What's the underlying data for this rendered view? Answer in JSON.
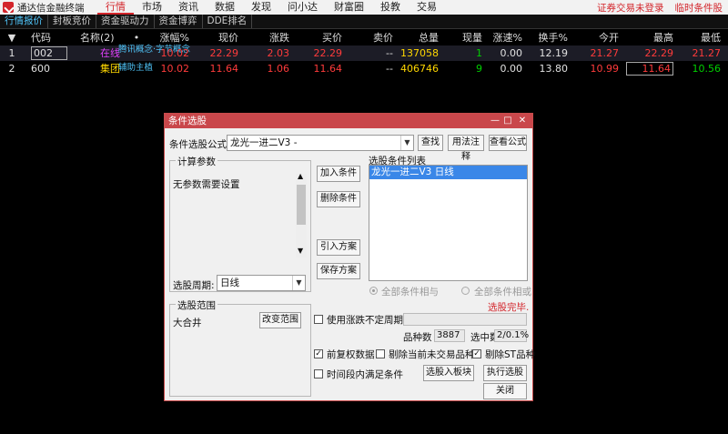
{
  "app": {
    "title": "通达信金融终端"
  },
  "menu": {
    "items": [
      "行情",
      "市场",
      "资讯",
      "数据",
      "发现",
      "问小达",
      "财富圈",
      "投教",
      "交易"
    ],
    "right": [
      "证券交易未登录",
      "临时条件股"
    ]
  },
  "subtabs": [
    "行情报价",
    "封板竞价",
    "资金驱动力",
    "资金博弈",
    "DDE排名"
  ],
  "table": {
    "headers": {
      "sort": "▼",
      "code": "代码",
      "name": "名称(2)",
      "dot": "•",
      "pct": "涨幅%",
      "price": "现价",
      "chg": "涨跌",
      "bid": "买价",
      "ask": "卖价",
      "vol": "总量",
      "cur": "现量",
      "spd": "涨速%",
      "turn": "换手%",
      "open": "今开",
      "high": "最高",
      "low": "最低"
    },
    "rows": [
      {
        "num": "1",
        "code": "002",
        "name": "在线",
        "tag": "腾讯概念·字节概念",
        "pct": "10.02",
        "price": "22.29",
        "chg": "2.03",
        "bid": "22.29",
        "ask": "--",
        "vol": "137058",
        "cur": "1",
        "spd": "0.00",
        "turn": "12.19",
        "open": "21.27",
        "high": "22.29",
        "low": "21.27"
      },
      {
        "num": "2",
        "code": "600",
        "name": "集团",
        "tag": "辅助主植",
        "pct": "10.02",
        "price": "11.64",
        "chg": "1.06",
        "bid": "11.64",
        "ask": "--",
        "vol": "406746",
        "cur": "9",
        "spd": "0.00",
        "turn": "13.80",
        "open": "10.99",
        "high": "11.64",
        "low": "10.56"
      }
    ]
  },
  "dialog": {
    "title": "条件选股",
    "formula_label": "条件选股公式",
    "formula_value": "龙光一进二V3  -",
    "btn_find": "查找",
    "btn_usage": "用法注释",
    "btn_view": "查看公式",
    "params_title": "计算参数",
    "params_text": "无参数需要设置",
    "period_label": "选股周期:",
    "period_value": "日线",
    "btn_add": "加入条件",
    "btn_delete": "删除条件",
    "btn_import": "引入方案",
    "btn_save": "保存方案",
    "cond_list_label": "选股条件列表",
    "cond_list_items": [
      "龙光一进二V3  日线"
    ],
    "radio_and": "全部条件相与",
    "radio_or": "全部条件相或",
    "status": "选股完毕.",
    "range_title": "选股范围",
    "range_value": "大合井",
    "btn_change_range": "改变范围",
    "chk_uncertain": "使用涨跌不定周期",
    "count_label": "品种数",
    "count_value": "3887",
    "selected_label": "选中数",
    "selected_value": "2/0.1%",
    "chk_adjusted": "前复权数据",
    "chk_remove_untraded": "剔除当前未交易品种",
    "chk_remove_st": "剔除ST品种",
    "chk_time": "时间段内满足条件",
    "btn_to_block": "选股入板块",
    "btn_execute": "执行选股",
    "btn_close": "关闭",
    "checks": {
      "uncertain": false,
      "adjusted": true,
      "remove_untraded": false,
      "remove_st": true,
      "time": false
    }
  },
  "colors": {
    "accent": "#d3252b",
    "up": "#ff3b3b",
    "down": "#00d000",
    "volume": "#ffd700",
    "title_bar": "#c9474b",
    "selection": "#3a87e8"
  }
}
